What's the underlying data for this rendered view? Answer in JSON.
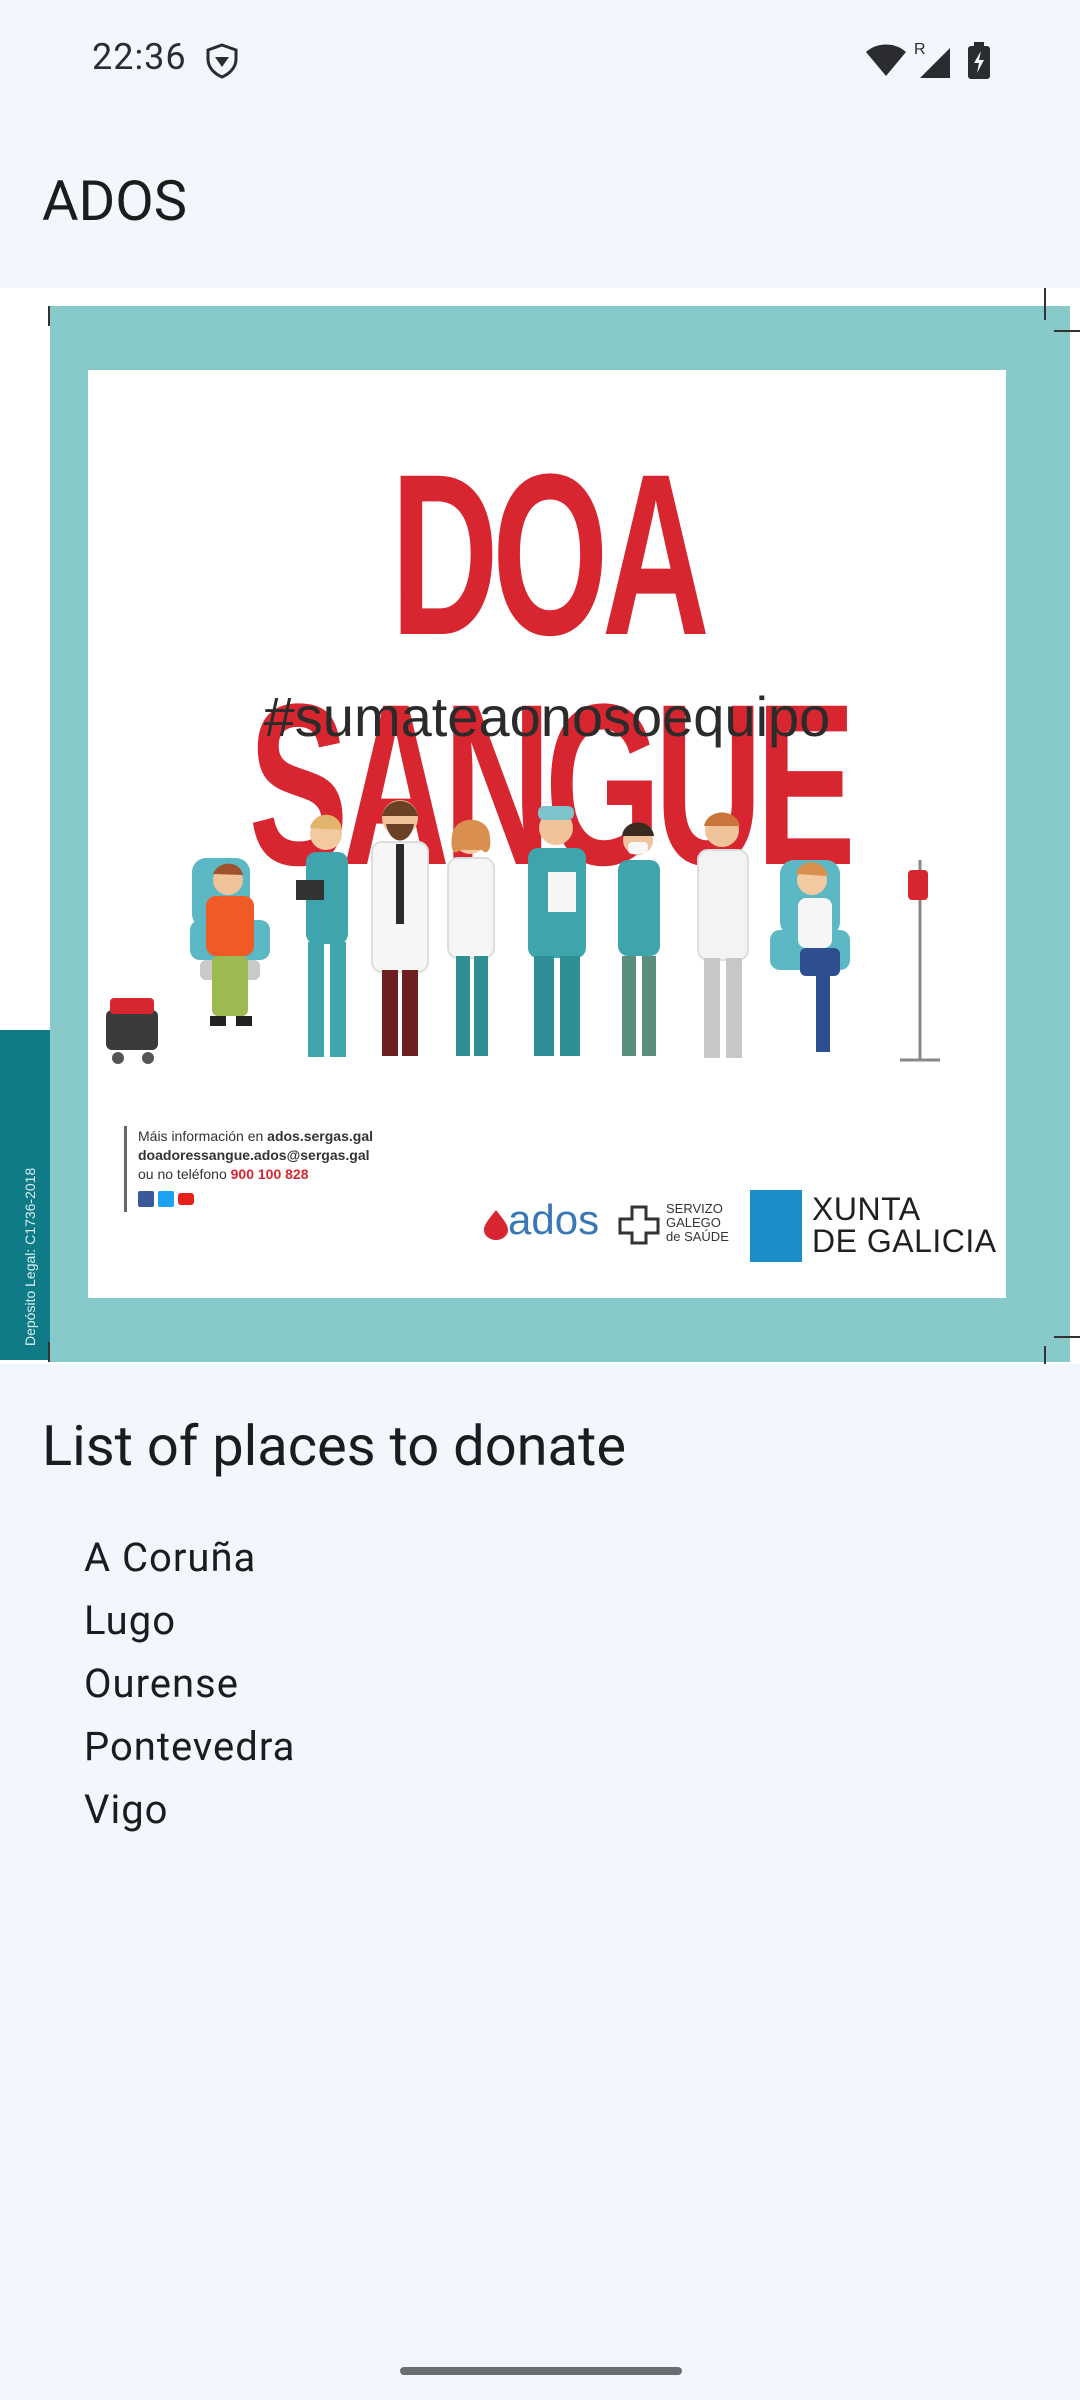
{
  "status_bar": {
    "time": "22:36",
    "icons": [
      "vpn-shield-icon",
      "wifi-icon",
      "signal-roaming-icon",
      "battery-charging-icon"
    ],
    "roaming_indicator": "R"
  },
  "app_bar": {
    "title": "ADOS"
  },
  "poster": {
    "headline": "DOA SANGUE",
    "hashtag": "#sumateaonosoequipo",
    "info_line_1_prefix": "Máis información en ",
    "info_line_1_link": "ados.sergas.gal",
    "info_line_2": "doadoressangue.ados@sergas.gal",
    "info_line_3_prefix": "ou no teléfono ",
    "info_line_3_phone": "900 100 828",
    "legal_text": "Depósito Legal: C1736-2018",
    "logo_ados_text": "ados",
    "logo_sergas_line_1": "SERVIZO",
    "logo_sergas_line_2": "GALEGO",
    "logo_sergas_line_3": "de SAÚDE",
    "logo_xunta_line_1": "XUNTA",
    "logo_xunta_line_2": "DE GALICIA",
    "colors": {
      "frame": "#88c9c9",
      "headline": "#d82631",
      "teal_strip": "#0e7b86",
      "xunta_blue": "#1d8ec9"
    }
  },
  "places_section": {
    "title": "List of places to donate",
    "items": [
      "A Coruña",
      "Lugo",
      "Ourense",
      "Pontevedra",
      "Vigo"
    ]
  },
  "colors": {
    "background": "#f1f7fd",
    "text": "#1a1c1e"
  }
}
